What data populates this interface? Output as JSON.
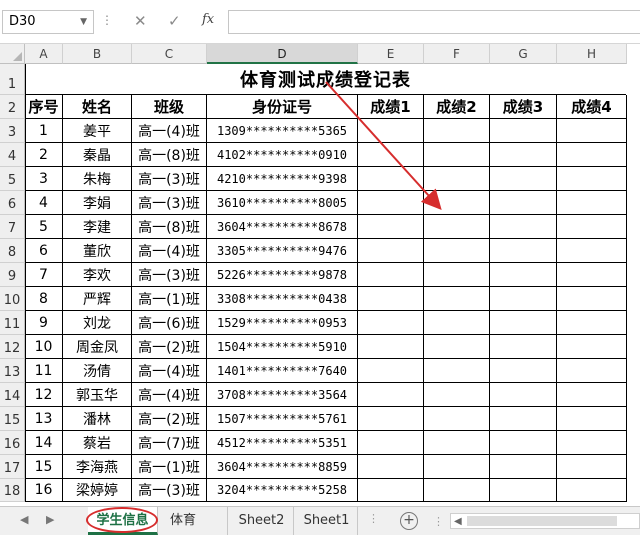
{
  "formula_bar": {
    "name_box": "D30",
    "dots": "⋮",
    "cancel_icon": "✕",
    "enter_icon": "✓",
    "fx_label": "fx",
    "formula": ""
  },
  "columns": [
    "A",
    "B",
    "C",
    "D",
    "E",
    "F",
    "G",
    "H"
  ],
  "rows": [
    "1",
    "2",
    "3",
    "4",
    "5",
    "6",
    "7",
    "8",
    "9",
    "10",
    "11",
    "12",
    "13",
    "14",
    "15",
    "16",
    "17",
    "18"
  ],
  "sheet": {
    "title": "体育测试成绩登记表",
    "headers": [
      "序号",
      "姓名",
      "班级",
      "身份证号",
      "成绩1",
      "成绩2",
      "成绩3",
      "成绩4"
    ],
    "records": [
      [
        "1",
        "姜平",
        "高一(4)班",
        "1309**********5365"
      ],
      [
        "2",
        "秦晶",
        "高一(8)班",
        "4102**********0910"
      ],
      [
        "3",
        "朱梅",
        "高一(3)班",
        "4210**********9398"
      ],
      [
        "4",
        "李娟",
        "高一(3)班",
        "3610**********8005"
      ],
      [
        "5",
        "李建",
        "高一(8)班",
        "3604**********8678"
      ],
      [
        "6",
        "董欣",
        "高一(4)班",
        "3305**********9476"
      ],
      [
        "7",
        "李欢",
        "高一(3)班",
        "5226**********9878"
      ],
      [
        "8",
        "严辉",
        "高一(1)班",
        "3308**********0438"
      ],
      [
        "9",
        "刘龙",
        "高一(6)班",
        "1529**********0953"
      ],
      [
        "10",
        "周金凤",
        "高一(2)班",
        "1504**********5910"
      ],
      [
        "11",
        "汤倩",
        "高一(4)班",
        "1401**********7640"
      ],
      [
        "12",
        "郭玉华",
        "高一(4)班",
        "3708**********3564"
      ],
      [
        "13",
        "潘林",
        "高一(2)班",
        "1507**********5761"
      ],
      [
        "14",
        "蔡岩",
        "高一(7)班",
        "4512**********5351"
      ],
      [
        "15",
        "李海燕",
        "高一(1)班",
        "3604**********8859"
      ],
      [
        "16",
        "梁婷婷",
        "高一(3)班",
        "3204**********5258"
      ]
    ]
  },
  "tabs": {
    "items": [
      "学生信息",
      "体育",
      "Sheet2",
      "Sheet1"
    ],
    "active": "学生信息",
    "add_label": "+",
    "more_label": "⋮"
  },
  "colors": {
    "accent": "#1e7145",
    "annotation": "#d62d2d"
  }
}
